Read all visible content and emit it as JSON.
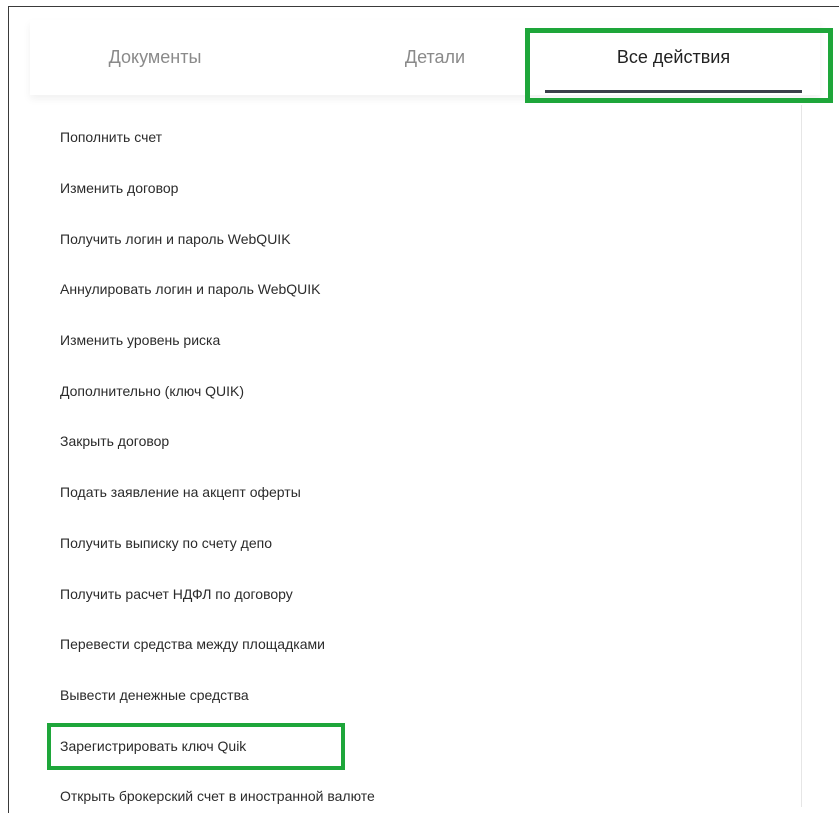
{
  "tabs": [
    {
      "label": "Документы",
      "active": false
    },
    {
      "label": "Детали",
      "active": false
    },
    {
      "label": "Все действия",
      "active": true
    }
  ],
  "actions": [
    "Пополнить счет",
    "Изменить договор",
    "Получить логин и пароль WebQUIK",
    "Аннулировать логин и пароль WebQUIK",
    "Изменить уровень риска",
    "Дополнительно (ключ QUIK)",
    "Закрыть договор",
    "Подать заявление на акцепт оферты",
    "Получить выписку по счету депо",
    "Получить расчет НДФЛ по договору",
    "Перевести средства между площадками",
    "Вывести денежные средства",
    "Зарегистрировать ключ Quik",
    "Открыть брокерский счет в иностранной валюте"
  ],
  "colors": {
    "highlight": "#1ea63a",
    "active_underline": "#3a3f4a",
    "inactive_tab_text": "#8a8a8a",
    "text": "#2b2b2b"
  }
}
